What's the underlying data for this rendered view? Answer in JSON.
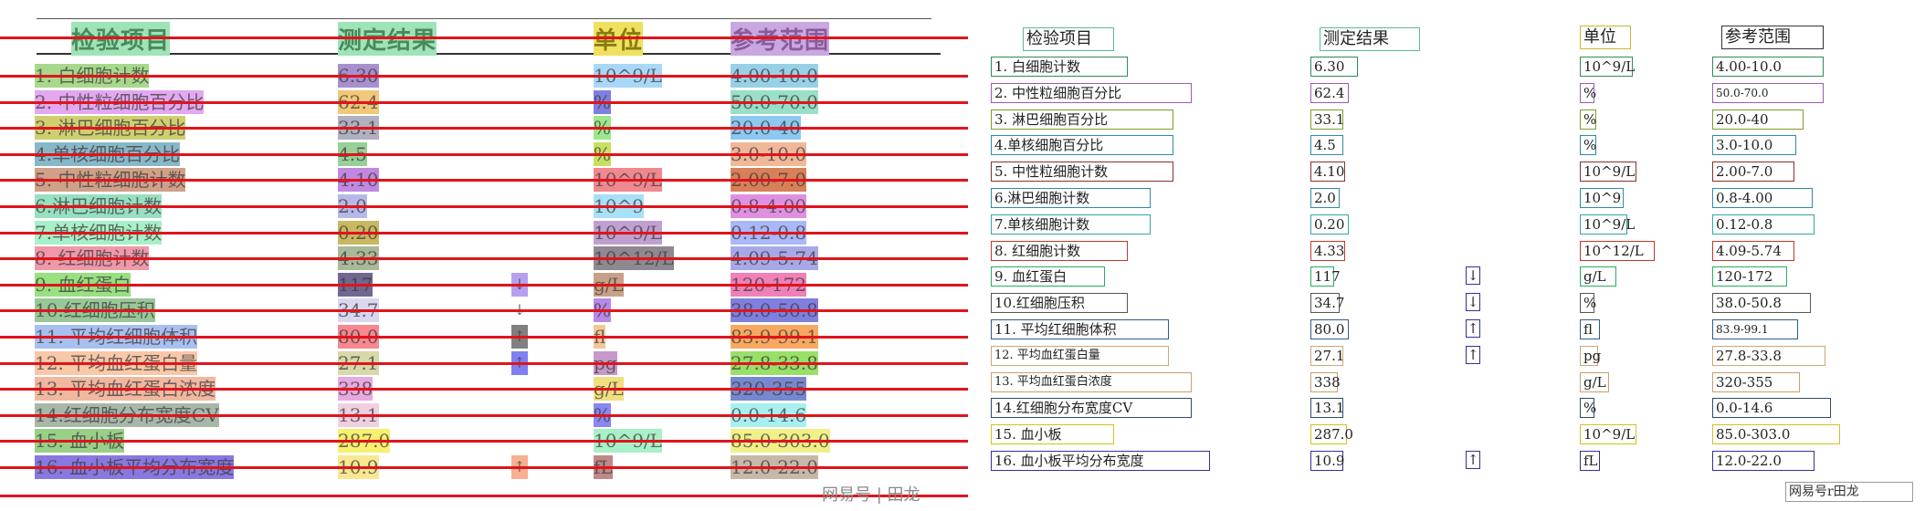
{
  "headers": [
    "检验项目",
    "测定结果",
    "单位",
    "参考范围"
  ],
  "header_colors": [
    "#9fe3b8",
    "#9fe3b8",
    "#f0e060",
    "#c9a7e2"
  ],
  "rows": [
    {
      "item": "1. 白细胞计数",
      "result": "6.30",
      "flag": "",
      "unit": "10^9/L",
      "range": "4.00-10.0",
      "colors": {
        "item": "#a8d88c",
        "result": "#a890d0",
        "unit": "#a8d8f8",
        "range": "#98d0e8"
      }
    },
    {
      "item": "2. 中性粒细胞百分比",
      "result": "62.4",
      "flag": "",
      "unit": "%",
      "range": "50.0-70.0",
      "colors": {
        "item": "#e3a8f0",
        "result": "#f0c878",
        "unit": "#7f7fe0",
        "range": "#98e0c8"
      }
    },
    {
      "item": "3. 淋巴细胞百分比",
      "result": "33.1",
      "flag": "",
      "unit": "%",
      "range": "20.0-40",
      "colors": {
        "item": "#cfcf70",
        "result": "#b0b0c0",
        "unit": "#9be88c",
        "range": "#8cc8f0"
      }
    },
    {
      "item": "4.单核细胞百分比",
      "result": "4.5",
      "flag": "",
      "unit": "%",
      "range": "3.0-10.0",
      "colors": {
        "item": "#88b8c8",
        "result": "#98d098",
        "unit": "#c8e060",
        "range": "#f0b898"
      }
    },
    {
      "item": "5. 中性粒细胞计数",
      "result": "4.10",
      "flag": "",
      "unit": "10^9/L",
      "range": "2.00-7.0",
      "colors": {
        "item": "#d0a088",
        "result": "#c088e0",
        "unit": "#f08890",
        "range": "#d88058"
      }
    },
    {
      "item": "6.淋巴细胞计数",
      "result": "2.0",
      "flag": "",
      "unit": "10^9",
      "range": "0.8-4.00",
      "colors": {
        "item": "#98e0c0",
        "result": "#b8b8e8",
        "unit": "#a8e0f8",
        "range": "#e090e0"
      }
    },
    {
      "item": "7.单核细胞计数",
      "result": "0.20",
      "flag": "",
      "unit": "10^9/L",
      "range": "0.12-0.8",
      "colors": {
        "item": "#a8f0c8",
        "result": "#c8b860",
        "unit": "#c0a0d0",
        "range": "#a8b8f8"
      }
    },
    {
      "item": "8. 红细胞计数",
      "result": "4.33",
      "flag": "",
      "unit": "10^12/L",
      "range": "4.09-5.74",
      "colors": {
        "item": "#f098a8",
        "result": "#a8b898",
        "unit": "#908890",
        "range": "#a8a8e8"
      }
    },
    {
      "item": "9. 血红蛋白",
      "result": "117",
      "flag": "↓",
      "unit": "g/L",
      "range": "120-172",
      "colors": {
        "item": "#98e080",
        "result": "#706890",
        "flag": "#b8a0f0",
        "unit": "#c8a088",
        "range": "#f080b8"
      }
    },
    {
      "item": "10.红细胞压积",
      "result": "34.7",
      "flag": "↓",
      "unit": "%",
      "range": "38.0-50.8",
      "colors": {
        "item": "#98c898",
        "result": "#d8d8f0",
        "flag": "#ffffff",
        "unit": "#b888e8",
        "range": "#7f7fe0"
      }
    },
    {
      "item": "11. 平均红细胞体积",
      "result": "80.0",
      "flag": "↑",
      "unit": "fl",
      "range": "83.9-99.1",
      "colors": {
        "item": "#a8c0f0",
        "result": "#f88890",
        "flag": "#808080",
        "unit": "#f0c898",
        "range": "#f8a860"
      }
    },
    {
      "item": "12. 平均血红蛋白量",
      "result": "27.1",
      "flag": "↑",
      "unit": "pg",
      "range": "27.8-33.8",
      "colors": {
        "item": "#f8c8a8",
        "result": "#d8d8a8",
        "flag": "#8080f0",
        "unit": "#c898c8",
        "range": "#98e068"
      }
    },
    {
      "item": "13. 平均血红蛋白浓度",
      "result": "338",
      "flag": "",
      "unit": "g/L",
      "range": "320-355",
      "colors": {
        "item": "#f0b8a0",
        "result": "#e8a8e0",
        "unit": "#f0e080",
        "range": "#7888d0"
      }
    },
    {
      "item": "14.红细胞分布宽度CV",
      "result": "13.1",
      "flag": "",
      "unit": "%",
      "range": "0.0-14.6",
      "colors": {
        "item": "#a8b8a8",
        "result": "#f0d0e0",
        "unit": "#8888f0",
        "range": "#a8f0f0"
      }
    },
    {
      "item": "15. 血小板",
      "result": "287.0",
      "flag": "",
      "unit": "10^9/L",
      "range": "85.0-303.0",
      "colors": {
        "item": "#98d088",
        "result": "#f8f070",
        "unit": "#a8f0c8",
        "range": "#f0f088"
      }
    },
    {
      "item": "16. 血小板平均分布宽度",
      "result": "10.9",
      "flag": "↑",
      "unit": "fL",
      "range": "12.0-22.0",
      "colors": {
        "item": "#8878e0",
        "result": "#f8e890",
        "flag": "#f8b090",
        "unit": "#c08888",
        "range": "#c8b8a8"
      }
    }
  ],
  "watermark": "网易号 | 田龙",
  "watermark_right": "网易号r田龙"
}
